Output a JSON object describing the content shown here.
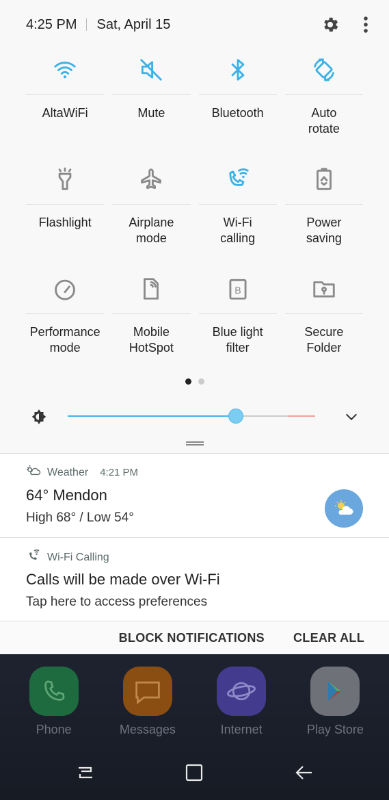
{
  "status_bar": {
    "time": "4:25 PM",
    "date": "Sat, April 15"
  },
  "quick_tiles": [
    {
      "label": "AltaWiFi",
      "icon": "wifi-icon",
      "active": true
    },
    {
      "label": "Mute",
      "icon": "mute-icon",
      "active": true
    },
    {
      "label": "Bluetooth",
      "icon": "bluetooth-icon",
      "active": true
    },
    {
      "label": "Auto\nrotate",
      "icon": "auto-rotate-icon",
      "active": true
    },
    {
      "label": "Flashlight",
      "icon": "flashlight-icon",
      "active": false
    },
    {
      "label": "Airplane\nmode",
      "icon": "airplane-icon",
      "active": false
    },
    {
      "label": "Wi-Fi\ncalling",
      "icon": "wifi-calling-icon",
      "active": true
    },
    {
      "label": "Power\nsaving",
      "icon": "power-saving-icon",
      "active": false
    },
    {
      "label": "Performance\nmode",
      "icon": "performance-icon",
      "active": false
    },
    {
      "label": "Mobile\nHotSpot",
      "icon": "hotspot-icon",
      "active": false
    },
    {
      "label": "Blue light\nfilter",
      "icon": "blue-light-icon",
      "active": false
    },
    {
      "label": "Secure\nFolder",
      "icon": "secure-folder-icon",
      "active": false
    }
  ],
  "page_indicator": {
    "pages": 2,
    "current": 1
  },
  "brightness": {
    "level": 0.68
  },
  "colors": {
    "accent": "#3cb1e6",
    "inactive": "#8a8a8a"
  },
  "notifications": {
    "weather": {
      "app": "Weather",
      "time": "4:21 PM",
      "title": "64° Mendon",
      "text": "High 68° / Low 54°"
    },
    "wifi_calling": {
      "app": "Wi-Fi Calling",
      "title": "Calls will be made over Wi-Fi",
      "text": "Tap here to access preferences"
    },
    "block_label": "BLOCK NOTIFICATIONS",
    "clear_label": "CLEAR ALL"
  },
  "dock": [
    {
      "label": "Phone",
      "icon": "phone-icon",
      "color": "#1f6b40"
    },
    {
      "label": "Messages",
      "icon": "messages-icon",
      "color": "#8a4d12"
    },
    {
      "label": "Internet",
      "icon": "internet-icon",
      "color": "#433c8e"
    },
    {
      "label": "Play Store",
      "icon": "play-store-icon",
      "color": "#6f7178"
    }
  ]
}
